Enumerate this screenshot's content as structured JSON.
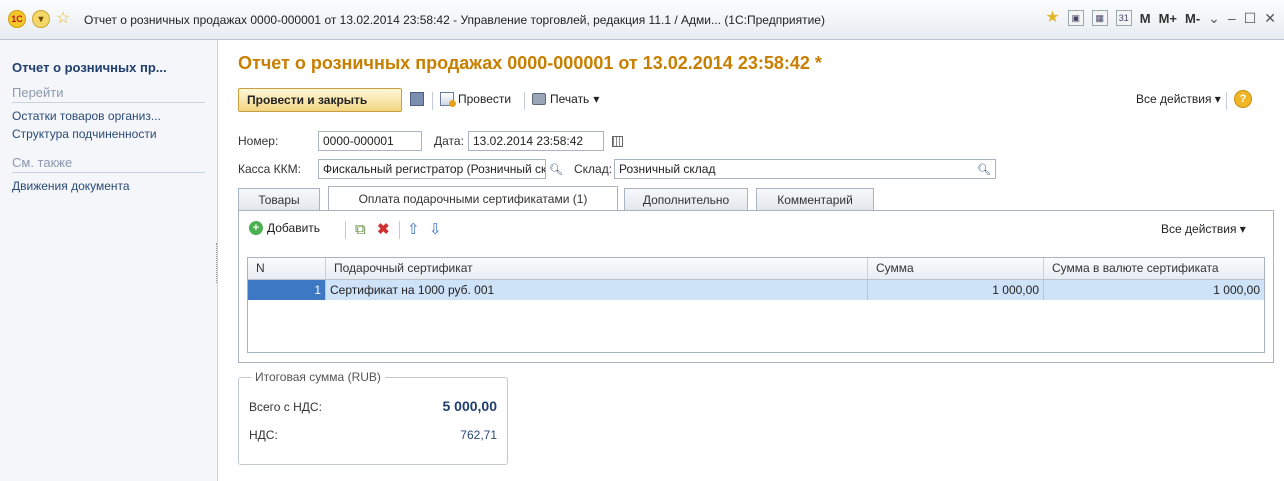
{
  "window": {
    "title": "Отчет о розничных продажах 0000-000001 от 13.02.2014 23:58:42 - Управление торговлей, редакция 11.1 / Адми... (1С:Предприятие)",
    "logo_text": "1С",
    "m_buttons": [
      "M",
      "M+",
      "M-"
    ]
  },
  "sidebar": {
    "title": "Отчет о розничных пр...",
    "groups": [
      {
        "label": "Перейти",
        "items": [
          "Остатки товаров организ...",
          "Структура подчиненности"
        ]
      },
      {
        "label": "См. также",
        "items": [
          "Движения документа"
        ]
      }
    ]
  },
  "document": {
    "title": "Отчет о розничных продажах 0000-000001 от 13.02.2014 23:58:42 *",
    "toolbar": {
      "post_close": "Провести и закрыть",
      "post": "Провести",
      "print": "Печать",
      "all_actions": "Все действия",
      "help": "?"
    },
    "fields": {
      "number_label": "Номер:",
      "number_value": "0000-000001",
      "date_label": "Дата:",
      "date_value": "13.02.2014 23:58:42",
      "kkm_label": "Касса ККМ:",
      "kkm_value": "Фискальный регистратор (Розничный склад",
      "warehouse_label": "Склад:",
      "warehouse_value": "Розничный склад"
    },
    "tabs": [
      "Товары",
      "Оплата подарочными сертификатами (1)",
      "Дополнительно",
      "Комментарий"
    ],
    "active_tab": 1,
    "table_toolbar": {
      "add": "Добавить",
      "all_actions": "Все действия"
    },
    "table": {
      "columns": [
        "N",
        "Подарочный сертификат",
        "Сумма",
        "Сумма в валюте сертификата"
      ],
      "rows": [
        [
          "1",
          "Сертификат на 1000 руб. 001",
          "1 000,00",
          "1 000,00"
        ]
      ]
    },
    "totals": {
      "legend": "Итоговая сумма (RUB)",
      "total_label": "Всего с НДС:",
      "total_value": "5 000,00",
      "vat_label": "НДС:",
      "vat_value": "762,71"
    }
  },
  "colors": {
    "title_orange": "#c87f00",
    "link_blue": "#2a4a78",
    "selection": "#cfe3f8",
    "accent_yellow": "#f2d683"
  }
}
